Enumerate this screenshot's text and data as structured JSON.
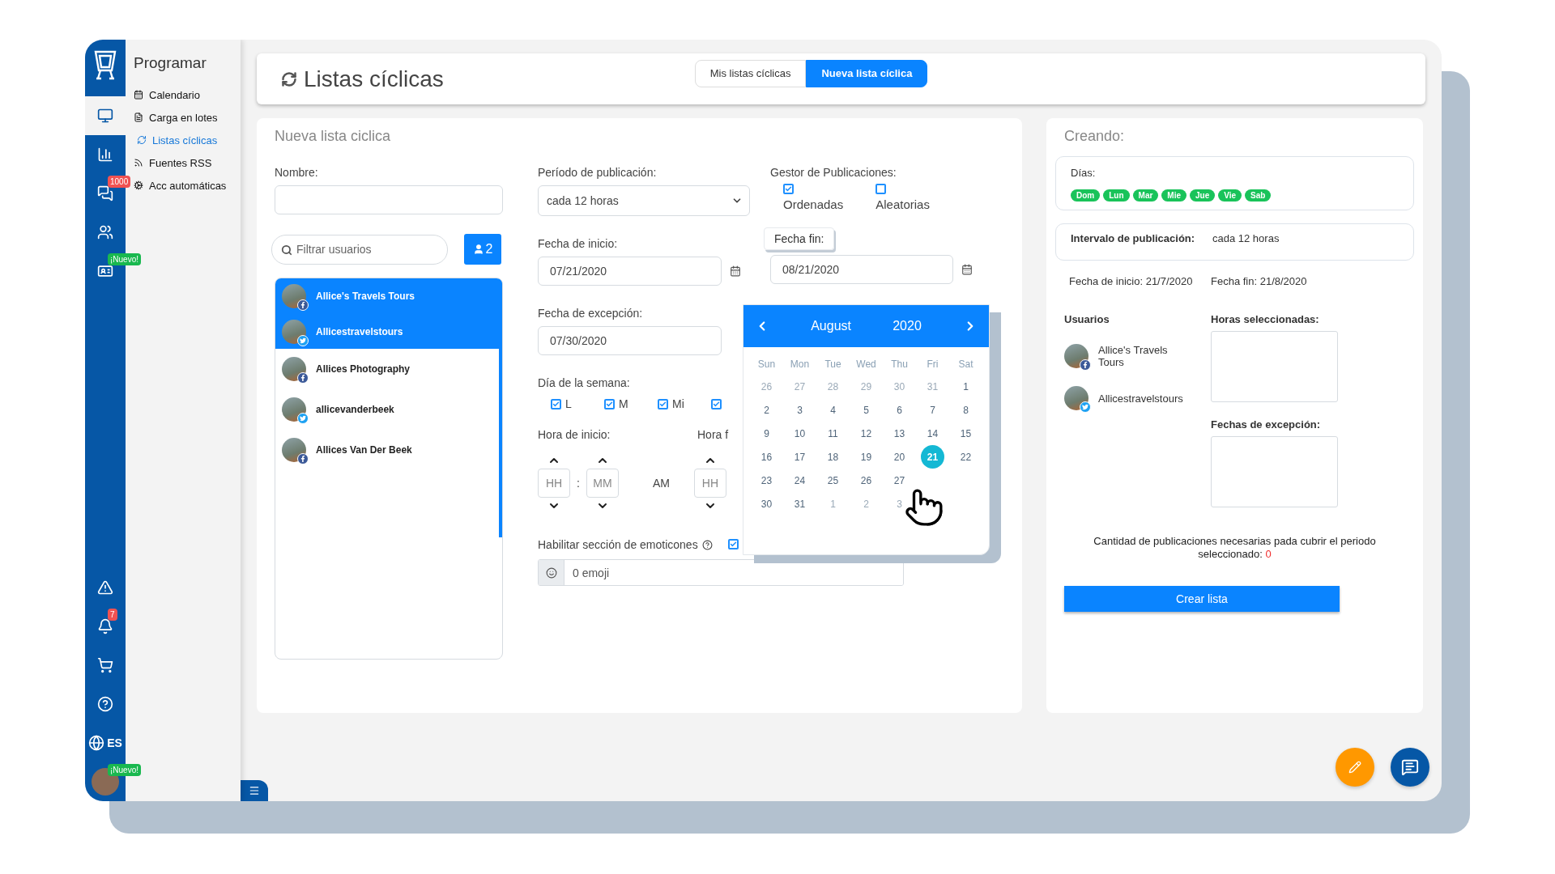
{
  "rail": {
    "top": [
      {
        "kind": "monitor",
        "selected": true
      },
      {
        "kind": "chart",
        "selected": false
      },
      {
        "kind": "chat",
        "selected": false,
        "badge": {
          "text": "1000",
          "color": "#f05252"
        }
      },
      {
        "kind": "users",
        "selected": false
      },
      {
        "kind": "idcard",
        "selected": false,
        "badge": {
          "text": "¡Nuevo!",
          "color": "#19b84f"
        }
      }
    ],
    "bottom": [
      {
        "kind": "warning",
        "selected": false
      },
      {
        "kind": "bell",
        "selected": false,
        "badge": {
          "text": "7",
          "color": "#f05252"
        }
      },
      {
        "kind": "cart",
        "selected": false
      },
      {
        "kind": "help",
        "selected": false
      },
      {
        "kind": "globe",
        "selected": false,
        "label": "ES"
      },
      {
        "kind": "avatar",
        "selected": false,
        "badge": {
          "text": "¡Nuevo!",
          "color": "#19b84f"
        }
      }
    ]
  },
  "nav": {
    "title": "Programar",
    "items": [
      {
        "kind": "calendar",
        "label": "Calendario",
        "selected": false
      },
      {
        "kind": "file",
        "label": "Carga en lotes",
        "selected": false
      },
      {
        "kind": "refresh",
        "label": "Listas cíclicas",
        "selected": true
      },
      {
        "kind": "rss",
        "label": "Fuentes RSS",
        "selected": false
      },
      {
        "kind": "cogs",
        "label": "Acc automáticas",
        "selected": false
      }
    ]
  },
  "header": {
    "title": "Listas cíclicas",
    "tabs": [
      {
        "label": "Mis listas cíclicas",
        "selected": false
      },
      {
        "label": "Nueva lista cíclica",
        "selected": true
      }
    ]
  },
  "form": {
    "title": "Nueva lista ciclica",
    "name_label": "Nombre:",
    "filter_placeholder": "Filtrar usuarios",
    "user_count": "2",
    "users": [
      {
        "name": "Allice's Travels Tours",
        "kind": "facebook",
        "selected": true
      },
      {
        "name": "Allicestravelstours",
        "kind": "twitter",
        "selected": true
      },
      {
        "name": "Allices Photography",
        "kind": "facebook",
        "selected": false
      },
      {
        "name": "allicevanderbeek",
        "kind": "twitter",
        "selected": false
      },
      {
        "name": "Allices Van Der Beek",
        "kind": "facebook",
        "selected": false
      }
    ],
    "period_label": "Período de publicación:",
    "period_value": "cada 12 horas",
    "manager_label": "Gestor de Publicaciones:",
    "manager_options": [
      {
        "label": "Ordenadas",
        "checked": true
      },
      {
        "label": "Aleatorias",
        "checked": false
      }
    ],
    "start_date_label": "Fecha de inicio:",
    "start_date": "07/21/2020",
    "end_date_label": "Fecha fin:",
    "end_date": "08/21/2020",
    "exception_label": "Fecha de excepción:",
    "exception_date": "07/30/2020",
    "weekday_label": "Día de la semana:",
    "weekdays": [
      {
        "label": "L",
        "checked": true
      },
      {
        "label": "M",
        "checked": true
      },
      {
        "label": "Mi",
        "checked": true
      },
      {
        "checked": true
      }
    ],
    "start_time_label": "Hora de inicio:",
    "end_time_label": "Hora f",
    "hour_placeholder": "HH",
    "minute_placeholder": "MM",
    "time_separator": ":",
    "meridiem": "AM",
    "end_hour_placeholder": "HH",
    "emoticons_label": "Habilitar sección de emoticones",
    "emoticons_checked": true,
    "emoji_value": "0 emoji"
  },
  "calendar": {
    "month": "August",
    "year": "2020",
    "weekdays": [
      "Sun",
      "Mon",
      "Tue",
      "Wed",
      "Thu",
      "Fri",
      "Sat"
    ],
    "weeks": [
      [
        {
          "d": "26",
          "muted": true,
          "selected": false
        },
        {
          "d": "27",
          "muted": true,
          "selected": false
        },
        {
          "d": "28",
          "muted": true,
          "selected": false
        },
        {
          "d": "29",
          "muted": true,
          "selected": false
        },
        {
          "d": "30",
          "muted": true,
          "selected": false
        },
        {
          "d": "31",
          "muted": true,
          "selected": false
        },
        {
          "d": "1",
          "muted": false,
          "selected": false
        }
      ],
      [
        {
          "d": "2",
          "muted": false,
          "selected": false
        },
        {
          "d": "3",
          "muted": false,
          "selected": false
        },
        {
          "d": "4",
          "muted": false,
          "selected": false
        },
        {
          "d": "5",
          "muted": false,
          "selected": false
        },
        {
          "d": "6",
          "muted": false,
          "selected": false
        },
        {
          "d": "7",
          "muted": false,
          "selected": false
        },
        {
          "d": "8",
          "muted": false,
          "selected": false
        }
      ],
      [
        {
          "d": "9",
          "muted": false,
          "selected": false
        },
        {
          "d": "10",
          "muted": false,
          "selected": false
        },
        {
          "d": "11",
          "muted": false,
          "selected": false
        },
        {
          "d": "12",
          "muted": false,
          "selected": false
        },
        {
          "d": "13",
          "muted": false,
          "selected": false
        },
        {
          "d": "14",
          "muted": false,
          "selected": false
        },
        {
          "d": "15",
          "muted": false,
          "selected": false
        }
      ],
      [
        {
          "d": "16",
          "muted": false,
          "selected": false
        },
        {
          "d": "17",
          "muted": false,
          "selected": false
        },
        {
          "d": "18",
          "muted": false,
          "selected": false
        },
        {
          "d": "19",
          "muted": false,
          "selected": false
        },
        {
          "d": "20",
          "muted": false,
          "selected": false
        },
        {
          "d": "21",
          "muted": false,
          "selected": true
        },
        {
          "d": "22",
          "muted": false,
          "selected": false
        }
      ],
      [
        {
          "d": "23",
          "muted": false,
          "selected": false
        },
        {
          "d": "24",
          "muted": false,
          "selected": false
        },
        {
          "d": "25",
          "muted": false,
          "selected": false
        },
        {
          "d": "26",
          "muted": false,
          "selected": false
        },
        {
          "d": "27",
          "muted": false,
          "selected": false
        }
      ],
      [
        {
          "d": "30",
          "muted": false,
          "selected": false
        },
        {
          "d": "31",
          "muted": false,
          "selected": false
        },
        {
          "d": "1",
          "muted": true,
          "selected": false
        },
        {
          "d": "2",
          "muted": true,
          "selected": false
        },
        {
          "d": "3",
          "muted": true,
          "selected": false
        }
      ]
    ]
  },
  "summary": {
    "title": "Creando:",
    "days_label": "Días:",
    "days": [
      "Dom",
      "Lun",
      "Mar",
      "Mie",
      "Jue",
      "Vie",
      "Sab"
    ],
    "interval_label": "Intervalo de publicación:",
    "interval_value": "cada 12 horas",
    "start": "Fecha de inicio: 21/7/2020",
    "end": "Fecha fin: 21/8/2020",
    "users_label": "Usuarios",
    "users": [
      {
        "name": "Allice's Travels Tours",
        "kind": "facebook"
      },
      {
        "name": "Allicestravelstours",
        "kind": "twitter"
      }
    ],
    "hours_label": "Horas seleccionadas:",
    "exceptions_label": "Fechas de excepción:",
    "note": "Cantidad de publicaciones necesarias pada cubrir el periodo seleccionado:",
    "count": "0",
    "button": "Crear lista"
  }
}
